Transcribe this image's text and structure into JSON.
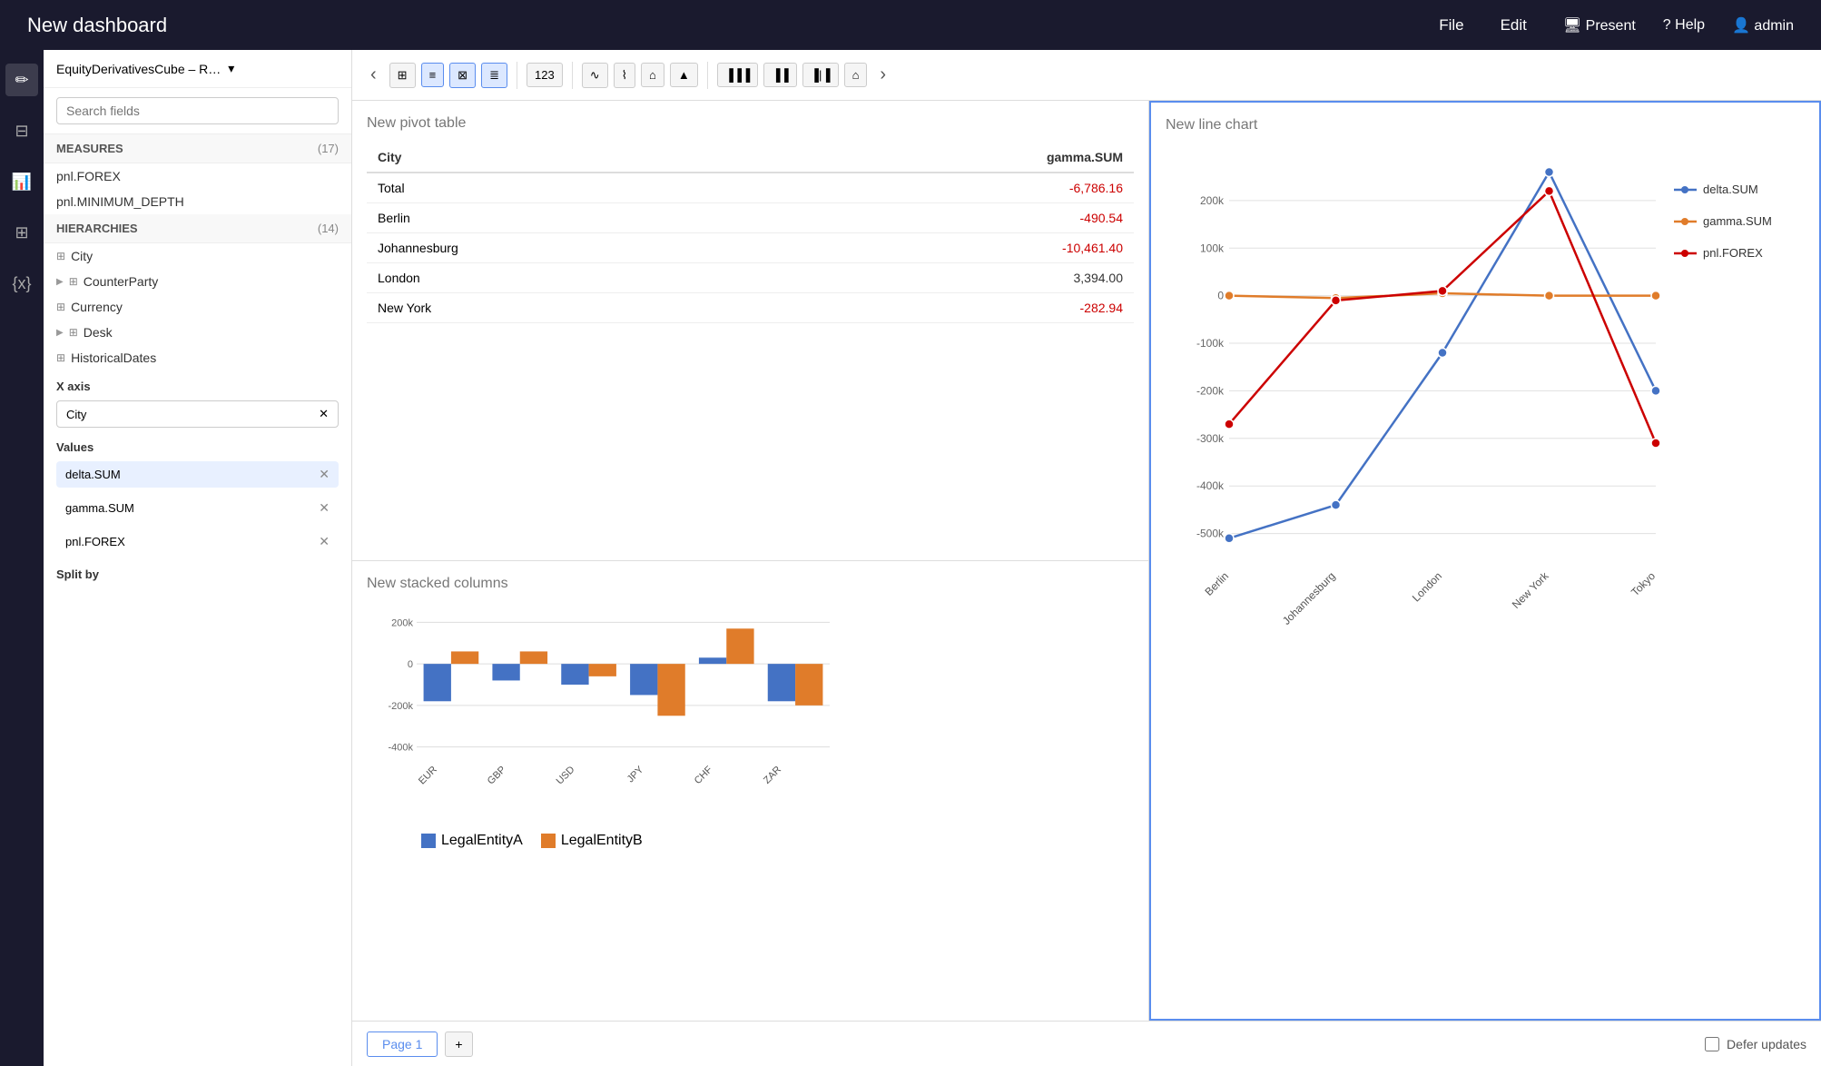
{
  "topbar": {
    "title": "New dashboard",
    "nav_items": [
      "File",
      "Edit"
    ],
    "actions": [
      "Present",
      "Help",
      "admin"
    ]
  },
  "sidebar": {
    "cube_selector_label": "EquityDerivativesCube – R…",
    "search_placeholder": "Search fields",
    "measures_label": "MEASURES",
    "measures_count": "(17)",
    "measures_items": [
      "pnl.FOREX",
      "pnl.MINIMUM_DEPTH"
    ],
    "hierarchies_label": "HIERARCHIES",
    "hierarchies_count": "(14)",
    "hierarchies_items": [
      {
        "label": "City",
        "expandable": false
      },
      {
        "label": "CounterParty",
        "expandable": true
      },
      {
        "label": "Currency",
        "expandable": false
      },
      {
        "label": "Desk",
        "expandable": true
      },
      {
        "label": "HistoricalDates",
        "expandable": false
      }
    ],
    "x_axis_label": "X axis",
    "x_axis_value": "City",
    "values_label": "Values",
    "values_items": [
      {
        "label": "delta.SUM",
        "highlighted": true
      },
      {
        "label": "gamma.SUM",
        "highlighted": false
      },
      {
        "label": "pnl.FOREX",
        "highlighted": false
      }
    ],
    "split_by_label": "Split by"
  },
  "toolbar": {
    "nav_prev": "‹",
    "nav_next": "›",
    "buttons": [
      {
        "label": "⊞",
        "active": false,
        "name": "table-icon"
      },
      {
        "label": "⊟",
        "active": true,
        "name": "flat-table-icon"
      },
      {
        "label": "⊠",
        "active": true,
        "name": "pivot-icon"
      },
      {
        "label": "≡",
        "active": true,
        "name": "list-icon"
      },
      {
        "label": "123",
        "active": false,
        "name": "number-icon"
      }
    ],
    "chart_buttons": [
      {
        "label": "∿",
        "name": "line-chart-btn"
      },
      {
        "label": "≋",
        "name": "area-chart-btn"
      },
      {
        "label": "≈",
        "name": "step-chart-btn"
      },
      {
        "label": "≈▲",
        "name": "area-step-chart-btn"
      },
      {
        "label": "▐▐▐",
        "name": "bar-chart-btn"
      },
      {
        "label": "▐▐",
        "name": "column-chart-btn"
      },
      {
        "label": "▐|▐",
        "name": "stacked-col-btn"
      },
      {
        "label": "⌂",
        "name": "waterfall-btn"
      }
    ]
  },
  "pivot_table": {
    "title": "New pivot table",
    "col_city": "City",
    "col_gamma": "gamma.SUM",
    "rows": [
      {
        "city": "Total",
        "value": "-6,786.16",
        "negative": true
      },
      {
        "city": "Berlin",
        "value": "-490.54",
        "negative": true
      },
      {
        "city": "Johannesburg",
        "value": "-10,461.40",
        "negative": true
      },
      {
        "city": "London",
        "value": "3,394.00",
        "negative": false
      },
      {
        "city": "New York",
        "value": "-282.94",
        "negative": true
      }
    ]
  },
  "stacked_chart": {
    "title": "New stacked columns",
    "legend": [
      {
        "label": "LegalEntityA",
        "color": "#4472c4"
      },
      {
        "label": "LegalEntityB",
        "color": "#e07c2a"
      }
    ],
    "categories": [
      "EUR",
      "GBP",
      "USD",
      "JPY",
      "CHF",
      "ZAR"
    ],
    "series_a": [
      -180000,
      -80000,
      -100000,
      -150000,
      30000,
      -180000
    ],
    "series_b": [
      60000,
      60000,
      -60000,
      -250000,
      170000,
      -200000
    ],
    "y_labels": [
      "200k",
      "0",
      "-200k",
      "-400k"
    ],
    "y_values": [
      200000,
      0,
      -200000,
      -400000
    ]
  },
  "line_chart": {
    "title": "New line chart",
    "series": [
      {
        "label": "delta.SUM",
        "color": "#4472c4"
      },
      {
        "label": "gamma.SUM",
        "color": "#e07c2a"
      },
      {
        "label": "pnl.FOREX",
        "color": "#cc0000"
      }
    ],
    "categories": [
      "Berlin",
      "Johannesburg",
      "London",
      "New York",
      "Tokyo"
    ],
    "delta_values": [
      -510000,
      -440000,
      -120000,
      260000,
      -200000
    ],
    "gamma_values": [
      0,
      -5000,
      5000,
      0,
      0
    ],
    "pnl_values": [
      -270000,
      -10000,
      10000,
      220000,
      -310000
    ],
    "y_labels": [
      "200k",
      "100k",
      "0",
      "-100k",
      "-200k",
      "-300k",
      "-400k",
      "-500k"
    ]
  },
  "page_bar": {
    "page_label": "Page 1",
    "add_label": "+",
    "defer_label": "Defer updates"
  }
}
